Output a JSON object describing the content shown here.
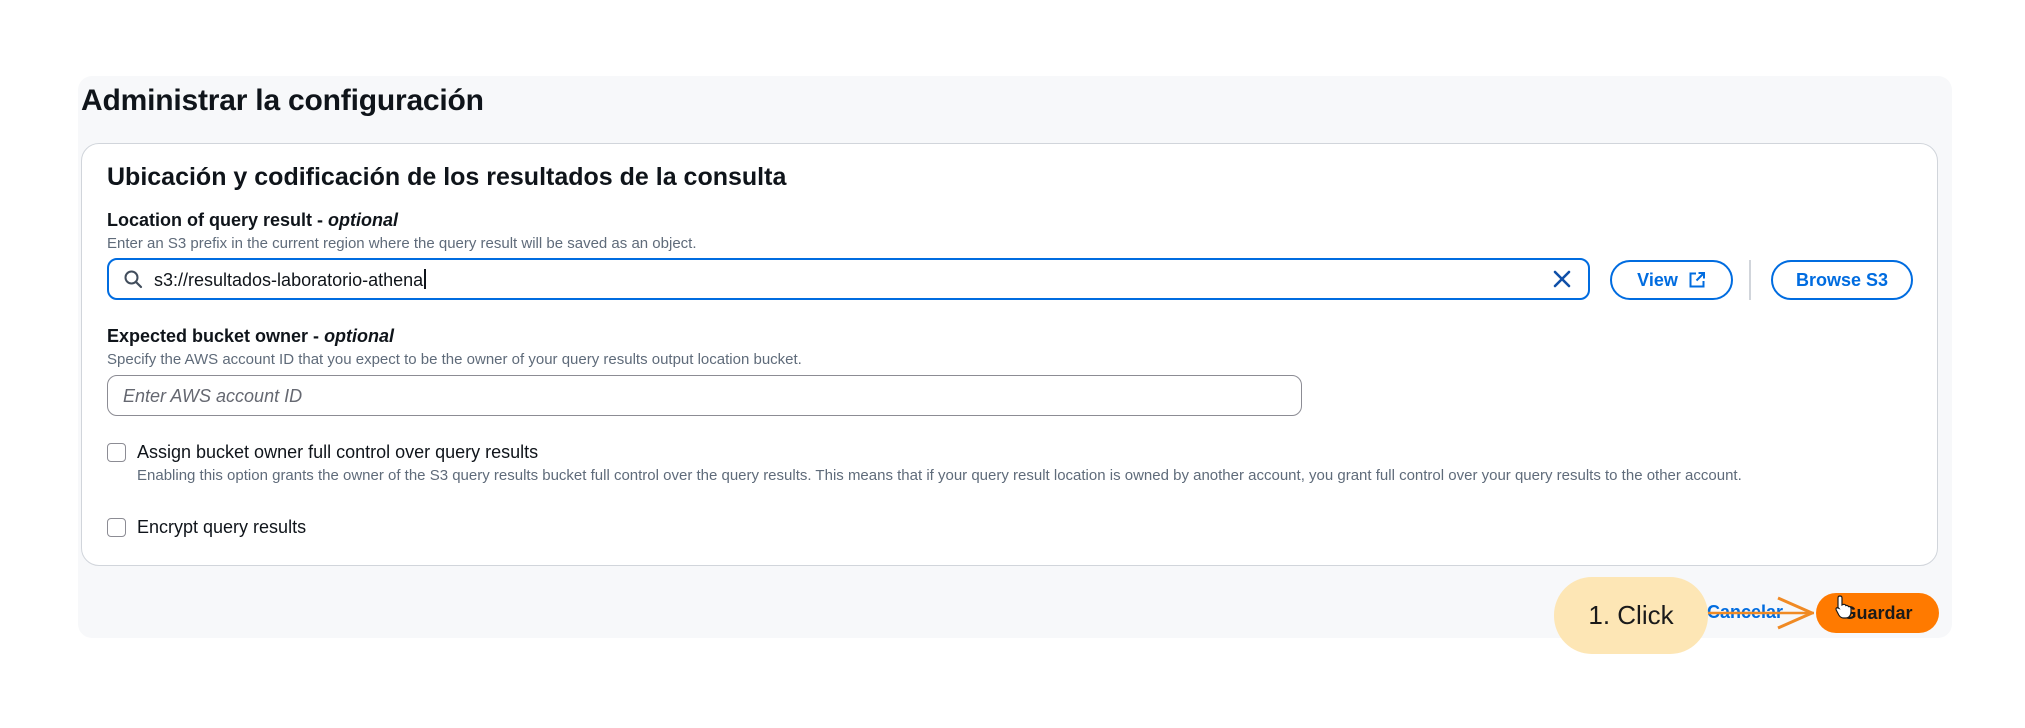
{
  "page": {
    "title": "Administrar la configuración"
  },
  "section": {
    "title": "Ubicación y codificación de los resultados de la consulta"
  },
  "query_location": {
    "label": "Location of query result - ",
    "label_optional": "optional",
    "description": "Enter an S3 prefix in the current region where the query result will be saved as an object.",
    "value": "s3://resultados-laboratorio-athena",
    "view_label": "View",
    "browse_label": "Browse S3"
  },
  "bucket_owner": {
    "label": "Expected bucket owner - ",
    "label_optional": "optional",
    "description": "Specify the AWS account ID that you expect to be the owner of your query results output location bucket.",
    "placeholder": "Enter AWS account ID"
  },
  "full_control": {
    "label": "Assign bucket owner full control over query results",
    "description": "Enabling this option grants the owner of the S3 query results bucket full control over the query results. This means that if your query result location is owned by another account, you grant full control over your query results to the other account.",
    "checked": false
  },
  "encrypt": {
    "label": "Encrypt query results",
    "checked": false
  },
  "actions": {
    "cancel_label": "Cancelar",
    "save_label": "Guardar"
  },
  "annotation": {
    "callout_text": "1. Click"
  },
  "colors": {
    "primary": "#006ce0",
    "save_button": "#ff7a00",
    "callout": "#fde6b5",
    "callout_arrow": "#f08a24"
  },
  "icons": [
    "search-icon",
    "clear-icon",
    "external-link-icon",
    "arrow-icon",
    "pointer-cursor-icon"
  ]
}
